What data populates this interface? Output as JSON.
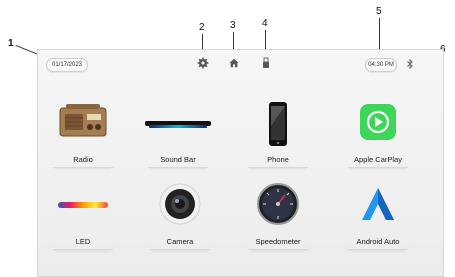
{
  "callouts": [
    "1",
    "2",
    "3",
    "4",
    "5",
    "6"
  ],
  "status_bar": {
    "date": "01/17/2023",
    "time": "04:30 PM"
  },
  "top_icons": [
    "settings-icon",
    "home-icon",
    "usb-icon",
    "bluetooth-icon"
  ],
  "apps": [
    {
      "label": "Radio",
      "icon": "radio-icon"
    },
    {
      "label": "Sound Bar",
      "icon": "sound-bar-icon"
    },
    {
      "label": "Phone",
      "icon": "phone-icon"
    },
    {
      "label": "Apple CarPlay",
      "icon": "carplay-icon"
    },
    {
      "label": "LED",
      "icon": "led-icon"
    },
    {
      "label": "Camera",
      "icon": "camera-icon"
    },
    {
      "label": "Speedometer",
      "icon": "speedometer-icon"
    },
    {
      "label": "Android Auto",
      "icon": "android-auto-icon"
    }
  ],
  "colors": {
    "carplay_green": "#3dd65a",
    "android_blue": "#2196f3"
  }
}
